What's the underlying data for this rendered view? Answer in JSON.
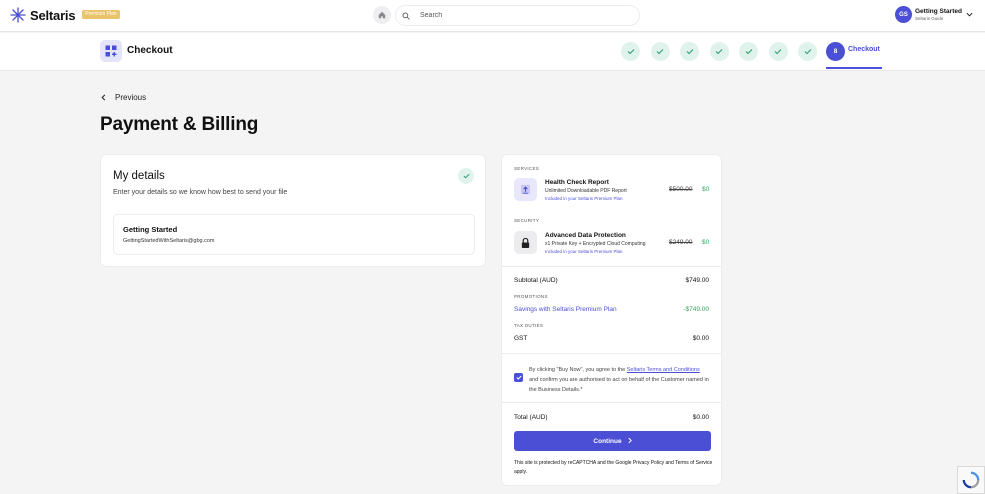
{
  "topbar": {
    "logo_text": "Seltaris",
    "badge_text": "Premium Plan",
    "search_placeholder": "Search",
    "user_initials": "GS",
    "user_name": "Getting Started",
    "user_sub": "Seltaris Guide"
  },
  "stepbar": {
    "title": "Checkout",
    "completed_steps": 7,
    "current_step_number": "8",
    "current_step_label": "Checkout"
  },
  "page": {
    "back_label": "Previous",
    "heading": "Payment & Billing"
  },
  "details": {
    "title": "My details",
    "subtitle": "Enter your details so we know how best to send your file",
    "contact_name": "Getting Started",
    "contact_email": "GettingStartedWithSeltaris@gbg.com"
  },
  "summary": {
    "services_label": "SERVICES",
    "service_item": {
      "name": "Health Check Report",
      "description": "Unlimited Downloadable PDF Report",
      "included": "Included in your Seltaris Premium Plan",
      "old_price": "$500.00",
      "price": "$0"
    },
    "security_label": "SECURITY",
    "security_item": {
      "name": "Advanced Data Protection",
      "description": "x1 Private Key + Encrypted Cloud Computing",
      "included": "Included in your Seltaris Premium Plan",
      "old_price": "$249.00",
      "price": "$0"
    },
    "subtotal_label": "Subtotal (AUD)",
    "subtotal_value": "$749.00",
    "promotions_label": "PROMOTIONS",
    "promo_label": "Savings with Seltaris Premium Plan",
    "promo_value": "-$749.00",
    "tax_label": "TAX DUTIES",
    "gst_label": "GST",
    "gst_value": "$0.00",
    "terms_pre": "By clicking \"Buy Now\", you agree to the ",
    "terms_link": "Seltaris Terms and Conditions",
    "terms_post": " and confirm you are authorised to act on behalf of the Customer named in the Business Details.*",
    "terms_checked": true,
    "total_label": "Total (AUD)",
    "total_value": "$0.00",
    "continue_label": "Continue",
    "captcha_note": "This site is protected by reCAPTCHA and the Google Privacy Policy and Terms of Service apply."
  },
  "colors": {
    "accent": "#4b4fd6",
    "success": "#3aa55d",
    "step_done_bg": "#dff3ec"
  },
  "icons": [
    "logo-icon",
    "home-icon",
    "search-icon",
    "chevron-down-icon",
    "grid-plus-icon",
    "check-icon",
    "chevron-left-icon",
    "upload-icon",
    "lock-icon",
    "chevron-right-icon",
    "recaptcha-icon"
  ]
}
